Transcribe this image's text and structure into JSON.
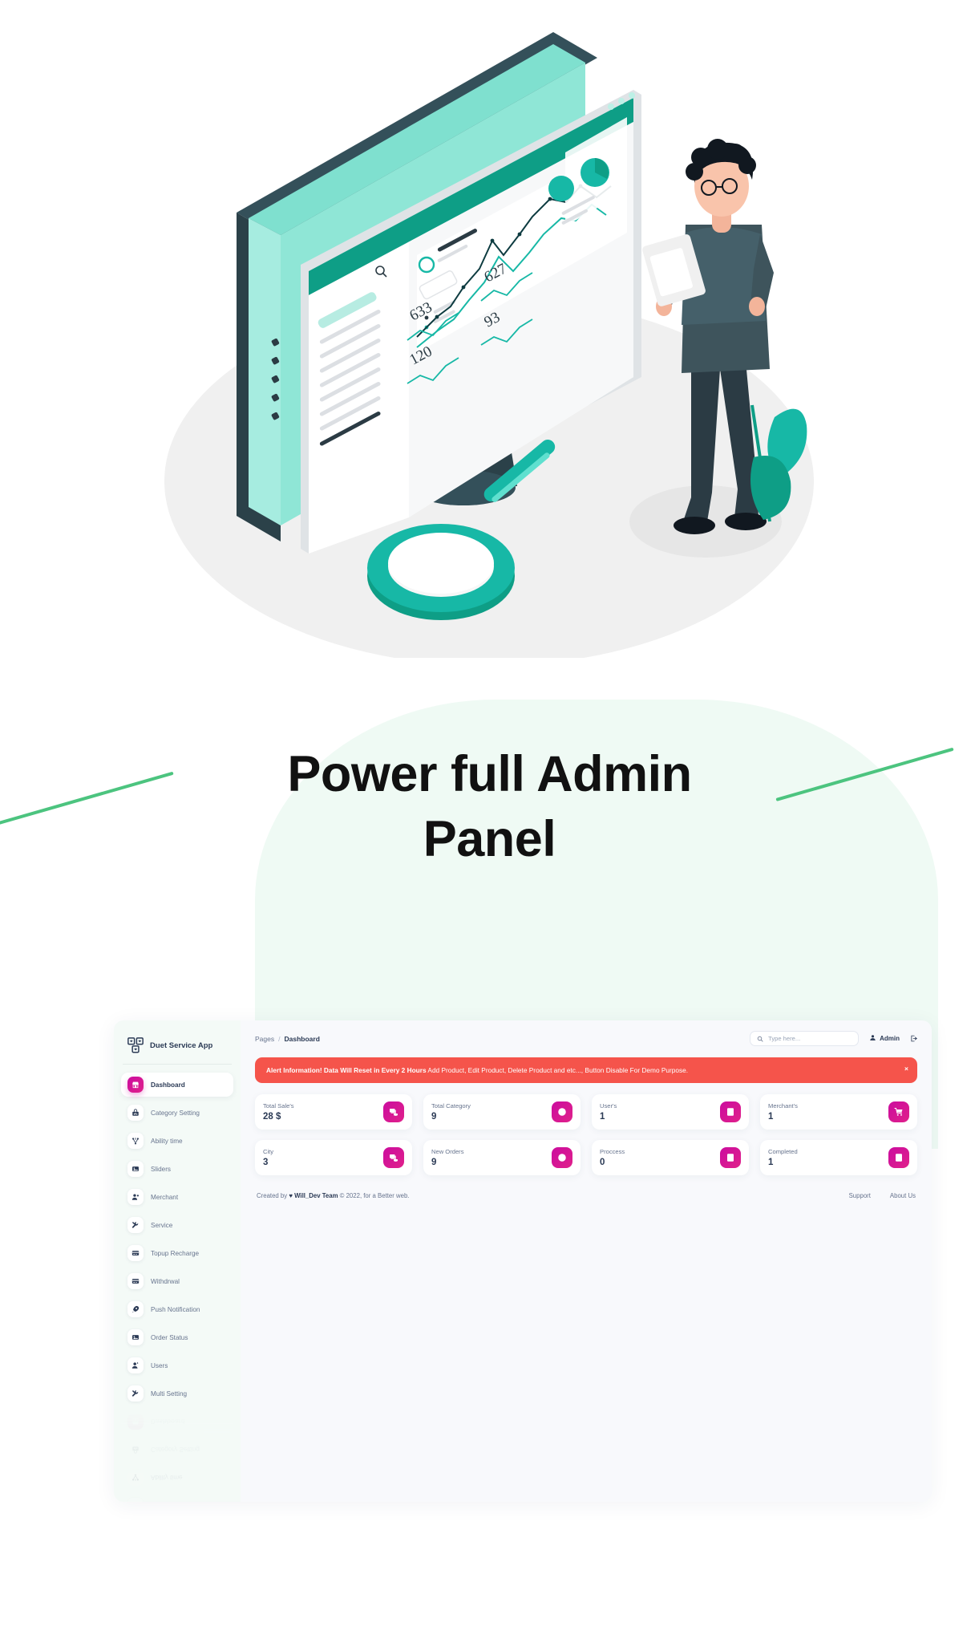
{
  "headline": {
    "line1": "Power full Admin",
    "line2": "Panel"
  },
  "colors": {
    "accent_green": "#4cc47f",
    "blob_bg": "#effaf4",
    "brand_pink": "#cb0c9f",
    "alert_red": "#f5544b",
    "text_dark": "#2b3a55",
    "text_muted": "#67748e",
    "teal": "#17b8a6"
  },
  "illustration": {
    "name": "isometric-dashboard-analytics-illustration",
    "numbers": [
      "627",
      "633",
      "93",
      "120"
    ],
    "elements": [
      "desktop-monitor",
      "browser-window",
      "person-with-clipboard",
      "magnifying-glass",
      "leaf-plant"
    ]
  },
  "panel": {
    "sidebar": {
      "logo_icon": "duet-grid-icon",
      "brand": "Duet Service App",
      "items": [
        {
          "label": "Dashboard",
          "icon": "store-icon",
          "active": true
        },
        {
          "label": "Category Setting",
          "icon": "chart-lock-icon",
          "active": false
        },
        {
          "label": "Ability time",
          "icon": "share-nodes-icon",
          "active": false
        },
        {
          "label": "Sliders",
          "icon": "image-icon",
          "active": false
        },
        {
          "label": "Merchant",
          "icon": "user-plus-icon",
          "active": false
        },
        {
          "label": "Service",
          "icon": "tools-icon",
          "active": false
        },
        {
          "label": "Topup Recharge",
          "icon": "credit-card-icon",
          "active": false
        },
        {
          "label": "Withdrwal",
          "icon": "credit-card-icon",
          "active": false
        },
        {
          "label": "Push Notification",
          "icon": "rocket-icon",
          "active": false
        },
        {
          "label": "Order Status",
          "icon": "image-icon",
          "active": false
        },
        {
          "label": "Users",
          "icon": "user-icon",
          "active": false
        },
        {
          "label": "Multi Setting",
          "icon": "tools-icon",
          "active": false
        }
      ]
    },
    "topbar": {
      "breadcrumb_root": "Pages",
      "breadcrumb_sep": "/",
      "breadcrumb_current": "Dashboard",
      "search_placeholder": "Type here...",
      "search_value": "",
      "search_icon": "search-icon",
      "admin_label": "Admin",
      "admin_icon": "user-icon",
      "logout_icon": "sign-out-icon"
    },
    "alert": {
      "title": "Alert Information! Data Will Reset in Every 2 Hours",
      "body": " Add Product, Edit Product, Delete Product and etc..., Button Disable For Demo Purpose.",
      "close_label": "×"
    },
    "stats_row1": [
      {
        "label": "Total Sale's",
        "value": "28 $",
        "icon": "money-stack-icon"
      },
      {
        "label": "Total Category",
        "value": "9",
        "icon": "globe-icon"
      },
      {
        "label": "User's",
        "value": "1",
        "icon": "id-card-icon"
      },
      {
        "label": "Merchant's",
        "value": "1",
        "icon": "cart-icon"
      }
    ],
    "stats_row2": [
      {
        "label": "City",
        "value": "3",
        "icon": "money-stack-icon"
      },
      {
        "label": "New Orders",
        "value": "9",
        "icon": "globe-icon"
      },
      {
        "label": "Proccess",
        "value": "0",
        "icon": "id-card-icon"
      },
      {
        "label": "Completed",
        "value": "1",
        "icon": "id-card-icon"
      }
    ],
    "footer": {
      "created_prefix": "Created by ",
      "heart": "♥",
      "team": "Will_Dev Team",
      "suffix": " © 2022, for a Better web.",
      "links": [
        "Support",
        "About Us"
      ]
    }
  }
}
